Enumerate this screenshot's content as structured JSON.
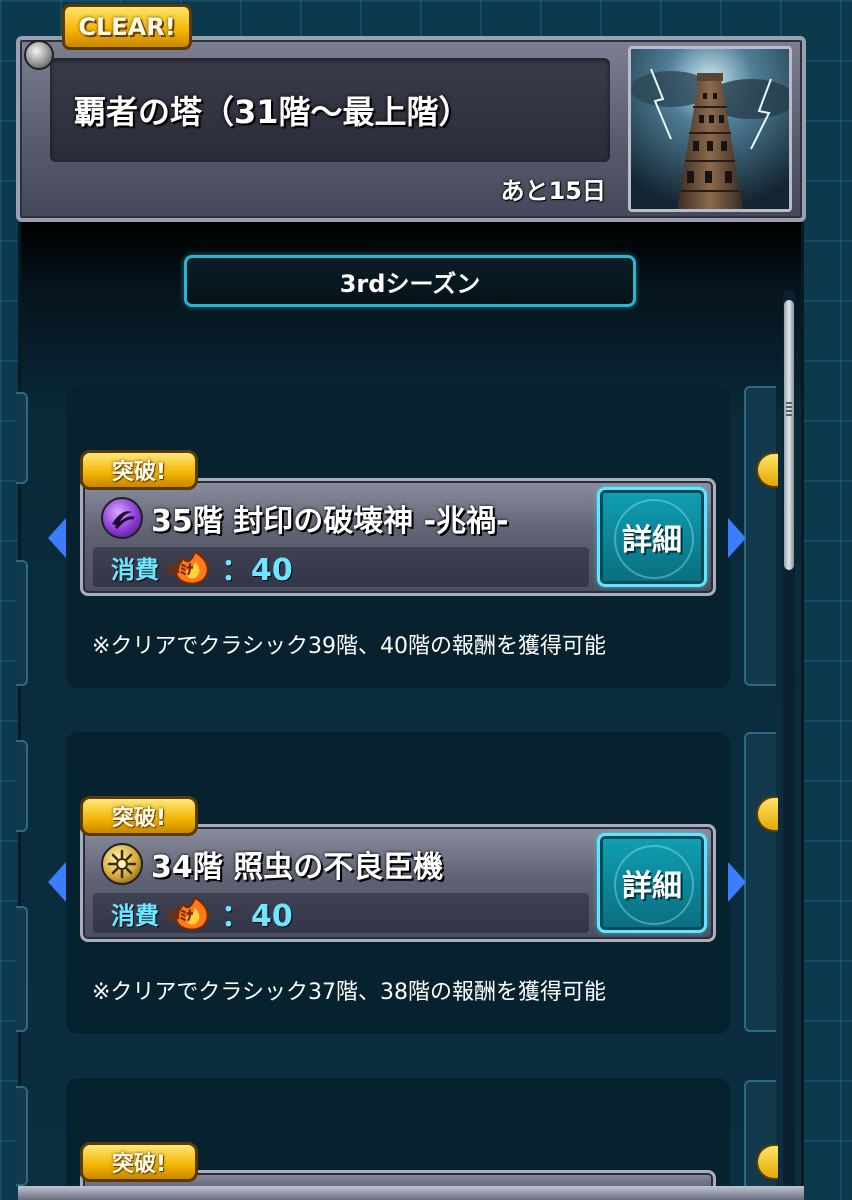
{
  "header": {
    "clear_badge": "CLEAR!",
    "title": "覇者の塔（31階～最上階）",
    "remaining": "あと15日",
    "thumbnail_icon": "tower-lightning-image"
  },
  "season": {
    "label": "3rdシーズン"
  },
  "quests": [
    {
      "badge": "突破!",
      "element_icon": "dark-element-icon",
      "name": "35階 封印の破壊神 -兆禍-",
      "stamina_label": "消費",
      "stamina_icon_text": "ｽﾀﾐﾅ",
      "stamina_value": "：40",
      "detail_button": "詳細",
      "reward": "※クリアでクラシック39階、40階の報酬を獲得可能"
    },
    {
      "badge": "突破!",
      "element_icon": "light-element-icon",
      "name": "34階 照虫の不良臣機",
      "stamina_label": "消費",
      "stamina_icon_text": "ｽﾀﾐﾅ",
      "stamina_value": "：40",
      "detail_button": "詳細",
      "reward": "※クリアでクラシック37階、38階の報酬を獲得可能"
    },
    {
      "badge": "突破!"
    }
  ],
  "colors": {
    "accent_cyan": "#6fe6ff",
    "badge_gold": "#f2b400",
    "nav_arrow_blue": "#3a7dff",
    "background_teal": "#0c3a4c"
  }
}
